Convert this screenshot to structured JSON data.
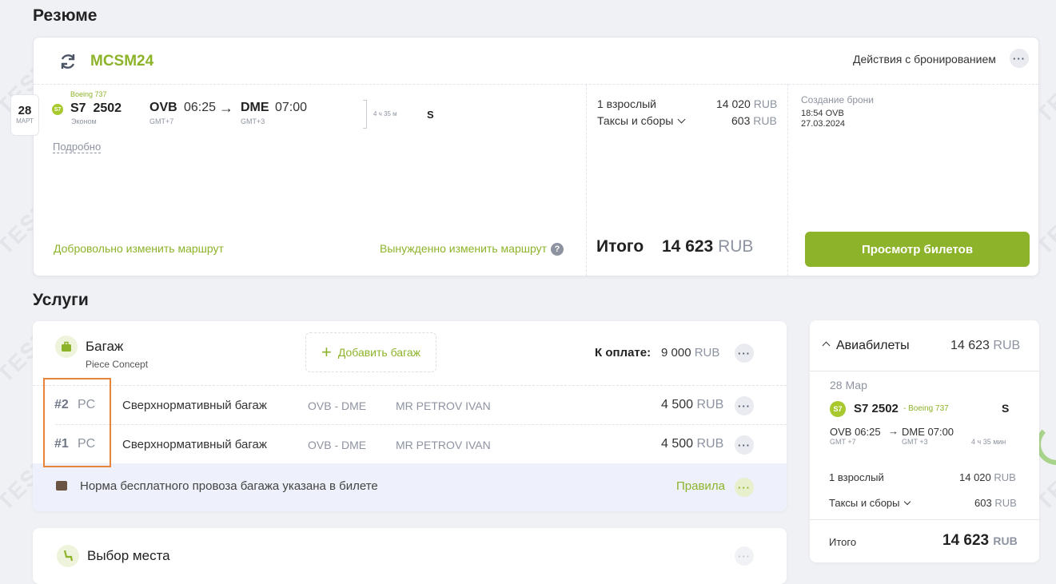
{
  "summary": {
    "title": "Резюме",
    "pnr": "MCSM24",
    "actions_label": "Действия с бронированием",
    "date_day": "28",
    "date_month": "МАРТ",
    "flight": {
      "aircraft": "Boeing 737",
      "airline_code": "S7",
      "number": "2502",
      "cabin": "Эконом",
      "from_code": "OVB",
      "from_time": "06:25",
      "from_tz": "GMT+7",
      "to_code": "DME",
      "to_time": "07:00",
      "to_tz": "GMT+3",
      "duration": "4 ч 35 м",
      "fare_class": "S"
    },
    "details_link": "Подробно",
    "voluntary_change": "Добровольно изменить маршрут",
    "forced_change": "Вынужденно изменить маршрут",
    "price": {
      "passengers": "1 взрослый",
      "fare": "14 020",
      "taxes_label": "Таксы и сборы",
      "taxes": "603",
      "currency": "RUB",
      "total_label": "Итого",
      "total": "14 623"
    },
    "booking": {
      "created_label": "Создание брони",
      "time_place": "18:54 OVB",
      "date": "27.03.2024"
    },
    "view_tickets_button": "Просмотр билетов"
  },
  "services": {
    "title": "Услуги",
    "baggage": {
      "title": "Багаж",
      "subtitle": "Piece Concept",
      "add_button": "Добавить багаж",
      "to_pay_label": "К оплате:",
      "to_pay_amount": "9 000",
      "currency": "RUB",
      "rows": [
        {
          "num": "#2",
          "unit": "PC",
          "name": "Сверхнормативный багаж",
          "route": "OVB - DME",
          "passenger": "MR PETROV IVAN",
          "price": "4 500"
        },
        {
          "num": "#1",
          "unit": "PC",
          "name": "Сверхнормативный багаж",
          "route": "OVB - DME",
          "passenger": "MR PETROV IVAN",
          "price": "4 500"
        }
      ],
      "note": "Норма бесплатного провоза багажа указана в билете",
      "rules_link": "Правила"
    },
    "seat": {
      "title": "Выбор места"
    }
  },
  "sidebar": {
    "header_title": "Авиабилеты",
    "header_total": "14 623",
    "currency": "RUB",
    "date": "28 Мар",
    "airline_code": "S7",
    "flight": "S7 2502",
    "aircraft": "- Boeing 737",
    "fare_class": "S",
    "from": "OVB 06:25",
    "arrow": "→",
    "to": "DME 07:00",
    "from_tz": "GMT +7",
    "to_tz": "GMT +3",
    "duration": "4 ч 35 мин",
    "passengers": "1 взрослый",
    "fare": "14 020",
    "taxes_label": "Таксы и сборы",
    "taxes": "603",
    "total_label": "Итого",
    "total": "14 623"
  },
  "watermark": "TEST",
  "colors": {
    "accent": "#8db32a",
    "highlight_border": "#e8843a",
    "note_bg": "#eef1fb"
  }
}
